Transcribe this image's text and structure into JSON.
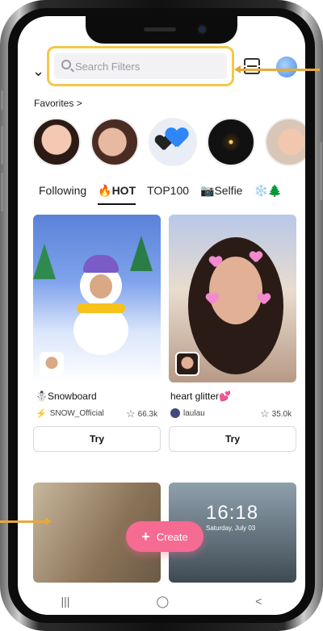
{
  "search": {
    "placeholder": "Search Filters"
  },
  "favorites": {
    "label": "Favorites",
    "chevron": ">"
  },
  "tabs": [
    {
      "label": "Following"
    },
    {
      "label": "🔥HOT"
    },
    {
      "label": "TOP100"
    },
    {
      "label": "📷Selfie"
    },
    {
      "label": "❄️🌲"
    }
  ],
  "cards": [
    {
      "title": "☃️Snowboard",
      "creator": "SNOW_Official",
      "stat": "66.3k",
      "button": "Try"
    },
    {
      "title": "heart glitter💕",
      "creator": "laulau",
      "stat": "35.0k",
      "button": "Try"
    }
  ],
  "lockscreen": {
    "time": "16:18",
    "date": "Saturday, July 03"
  },
  "create_button": {
    "label": "Create",
    "plus": "+"
  },
  "navbar": {
    "recents": "|||",
    "home": "◯",
    "back": "<"
  },
  "icons": {
    "back_chevron": "chevron-down-icon",
    "scan": "scan-icon",
    "star": "star-icon"
  },
  "colors": {
    "accent": "#f56b92",
    "highlight": "#f3c84b",
    "verified": "#23a7e6"
  }
}
